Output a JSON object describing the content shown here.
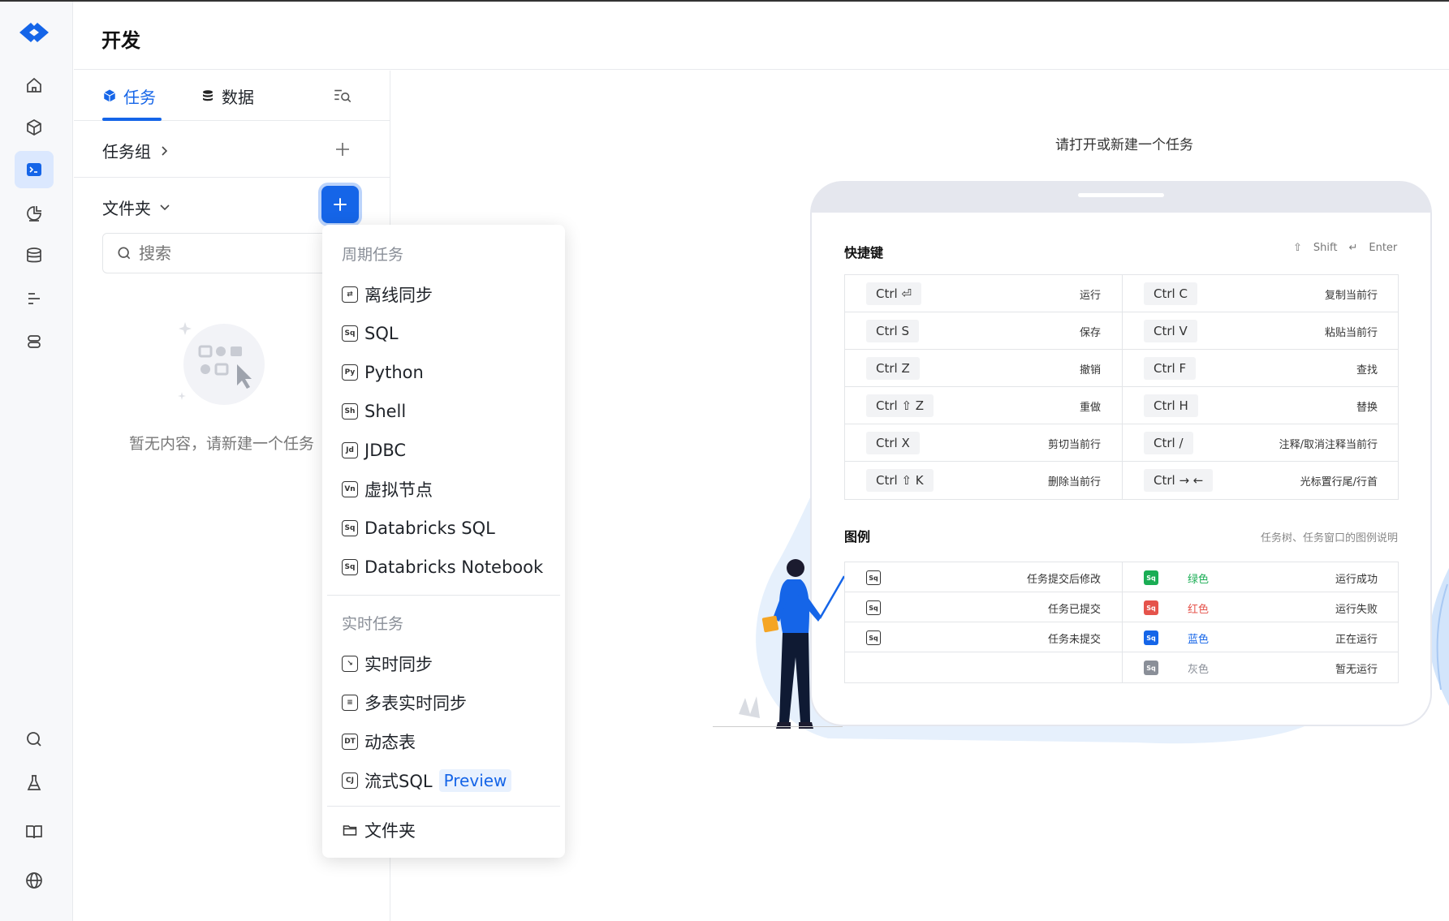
{
  "page": {
    "title": "开发"
  },
  "rail": {
    "items": [
      "home-icon",
      "cube-icon",
      "terminal-icon",
      "chart-icon",
      "database-icon",
      "list-icon",
      "server-icon",
      "search-icon",
      "flask-icon",
      "book-icon",
      "globe-icon"
    ]
  },
  "panel": {
    "tabs": [
      {
        "label": "任务",
        "active": true
      },
      {
        "label": "数据",
        "active": false
      }
    ],
    "task_group_label": "任务组",
    "folder_label": "文件夹",
    "search_placeholder": "搜索",
    "empty_text": "暂无内容，请新建一个任务"
  },
  "dropdown": {
    "periodic_group": "周期任务",
    "periodic_items": [
      {
        "label": "离线同步",
        "icon": "sync"
      },
      {
        "label": "SQL",
        "icon": "Sq"
      },
      {
        "label": "Python",
        "icon": "Py"
      },
      {
        "label": "Shell",
        "icon": "Sh"
      },
      {
        "label": "JDBC",
        "icon": "Jd"
      },
      {
        "label": "虚拟节点",
        "icon": "Vn"
      },
      {
        "label": "Databricks SQL",
        "icon": "Sq"
      },
      {
        "label": "Databricks Notebook",
        "icon": "Sq"
      }
    ],
    "realtime_group": "实时任务",
    "realtime_items": [
      {
        "label": "实时同步",
        "icon": "rt"
      },
      {
        "label": "多表实时同步",
        "icon": "mt"
      },
      {
        "label": "动态表",
        "icon": "DT"
      },
      {
        "label": "流式SQL",
        "icon": "CJ",
        "badge": "Preview"
      }
    ],
    "folder_item": "文件夹"
  },
  "main": {
    "hint": "请打开或新建一个任务",
    "shortcuts_title": "快捷键",
    "shift_hint": "Shift",
    "enter_hint": "Enter",
    "shortcuts": [
      {
        "keys": "Ctrl ⏎",
        "desc": "运行"
      },
      {
        "keys": "Ctrl C",
        "desc": "复制当前行"
      },
      {
        "keys": "Ctrl S",
        "desc": "保存"
      },
      {
        "keys": "Ctrl V",
        "desc": "粘贴当前行"
      },
      {
        "keys": "Ctrl Z",
        "desc": "撤销"
      },
      {
        "keys": "Ctrl F",
        "desc": "查找"
      },
      {
        "keys": "Ctrl ⇧ Z",
        "desc": "重做"
      },
      {
        "keys": "Ctrl H",
        "desc": "替换"
      },
      {
        "keys": "Ctrl X",
        "desc": "剪切当前行"
      },
      {
        "keys": "Ctrl /",
        "desc": "注释/取消注释当前行"
      },
      {
        "keys": "Ctrl ⇧ K",
        "desc": "删除当前行"
      },
      {
        "keys": "Ctrl → ←",
        "desc": "光标置行尾/行首"
      }
    ],
    "legend_title": "图例",
    "legend_note": "任务树、任务窗口的图例说明",
    "legend_left": [
      {
        "desc": "任务提交后修改"
      },
      {
        "desc": "任务已提交"
      },
      {
        "desc": "任务未提交"
      }
    ],
    "legend_right": [
      {
        "color_name": "绿色",
        "color": "#1aad54",
        "desc": "运行成功"
      },
      {
        "color_name": "红色",
        "color": "#e5534b",
        "desc": "运行失败"
      },
      {
        "color_name": "蓝色",
        "color": "#1565e8",
        "desc": "正在运行"
      },
      {
        "color_name": "灰色",
        "color": "#8a8f98",
        "desc": "暂无运行"
      }
    ]
  },
  "colors": {
    "accent": "#1565e8"
  }
}
